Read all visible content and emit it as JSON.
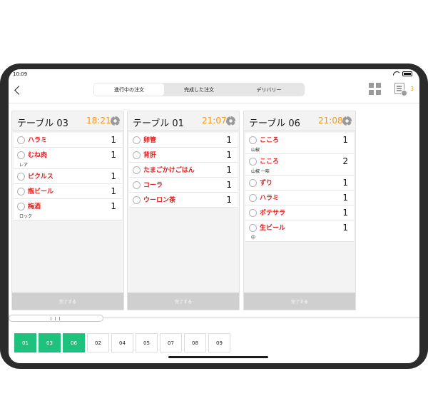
{
  "status": {
    "time": "10:09"
  },
  "toolbar": {
    "segments": [
      "進行中の注文",
      "完成した注文",
      "デリバリー"
    ],
    "pending_count": "3"
  },
  "orders": [
    {
      "title": "テーブル  03",
      "time": "18:21",
      "items": [
        {
          "name": "ハラミ",
          "qty": "1"
        },
        {
          "name": "むね肉",
          "qty": "1",
          "note": "レア"
        },
        {
          "name": "ピクルス",
          "qty": "1"
        },
        {
          "name": "瓶ビール",
          "qty": "1"
        },
        {
          "name": "梅酒",
          "qty": "1",
          "note": "ロック"
        }
      ],
      "complete_label": "完了する"
    },
    {
      "title": "テーブル  01",
      "time": "21:07",
      "items": [
        {
          "name": "卵管",
          "qty": "1"
        },
        {
          "name": "背肝",
          "qty": "1"
        },
        {
          "name": "たまごかけごはん",
          "qty": "1"
        },
        {
          "name": "コーラ",
          "qty": "1"
        },
        {
          "name": "ウーロン茶",
          "qty": "1"
        }
      ],
      "complete_label": "完了する"
    },
    {
      "title": "テーブル  06",
      "time": "21:08",
      "items": [
        {
          "name": "こころ",
          "qty": "1",
          "note": "山椒"
        },
        {
          "name": "こころ",
          "qty": "2",
          "note": "山椒 一味"
        },
        {
          "name": "ずり",
          "qty": "1"
        },
        {
          "name": "ハラミ",
          "qty": "1"
        },
        {
          "name": "ポテサラ",
          "qty": "1"
        },
        {
          "name": "生ビール",
          "qty": "1",
          "note": "中"
        }
      ],
      "complete_label": "完了する"
    }
  ],
  "tables": [
    {
      "label": "01",
      "active": true
    },
    {
      "label": "03",
      "active": true
    },
    {
      "label": "06",
      "active": true
    },
    {
      "label": "02",
      "active": false
    },
    {
      "label": "04",
      "active": false
    },
    {
      "label": "05",
      "active": false
    },
    {
      "label": "07",
      "active": false
    },
    {
      "label": "08",
      "active": false
    },
    {
      "label": "09",
      "active": false
    }
  ],
  "colors": {
    "accent_green": "#1ec27c",
    "time_orange": "#f39b1a",
    "item_red": "#e02020"
  }
}
